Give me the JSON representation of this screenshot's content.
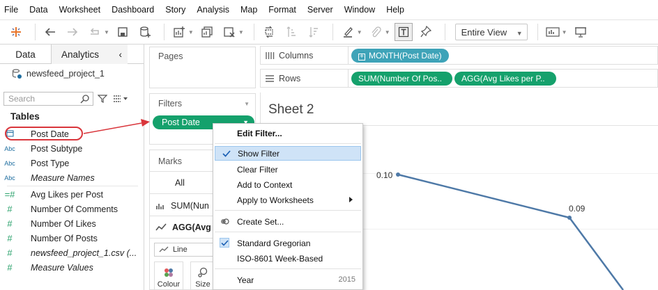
{
  "menu": [
    "File",
    "Data",
    "Worksheet",
    "Dashboard",
    "Story",
    "Analysis",
    "Map",
    "Format",
    "Server",
    "Window",
    "Help"
  ],
  "toolbar": {
    "fit_label": "Entire View"
  },
  "datapane": {
    "tab_data": "Data",
    "tab_analytics": "Analytics",
    "datasource": "newsfeed_project_1",
    "search_placeholder": "Search",
    "tables_heading": "Tables",
    "fields": [
      {
        "icon": "calendar",
        "label": "Post Date"
      },
      {
        "icon": "Abc",
        "label": "Post Subtype"
      },
      {
        "icon": "Abc",
        "label": "Post Type"
      },
      {
        "icon": "Abc",
        "label": "Measure Names"
      },
      {
        "icon": "=#",
        "label": "Avg Likes per Post"
      },
      {
        "icon": "#",
        "label": "Number Of Comments"
      },
      {
        "icon": "#",
        "label": "Number Of Likes"
      },
      {
        "icon": "#",
        "label": "Number Of Posts"
      },
      {
        "icon": "#",
        "label": "newsfeed_project_1.csv (..."
      },
      {
        "icon": "#",
        "label": "Measure Values"
      }
    ]
  },
  "cards": {
    "pages": "Pages",
    "filters": "Filters",
    "filter_pill": "Post Date",
    "marks": "Marks",
    "marks_all": "All",
    "marks_sum": "SUM(Nun",
    "marks_agg": "AGG(Avg",
    "mark_type": "Line",
    "color_label": "Colour",
    "size_label": "Size"
  },
  "shelves": {
    "columns_label": "Columns",
    "rows_label": "Rows",
    "columns_pill": "MONTH(Post Date)",
    "rows_pill_1": "SUM(Number Of Pos..",
    "rows_pill_2": "AGG(Avg Likes per P.."
  },
  "sheet": {
    "title": "Sheet 2",
    "label_a": "0.10",
    "label_b": "0.09"
  },
  "chart_data": {
    "type": "line",
    "title": "Sheet 2",
    "series": [
      {
        "values": [
          0.1,
          0.09
        ]
      }
    ]
  },
  "context_menu": {
    "edit_filter": "Edit Filter...",
    "show_filter": "Show Filter",
    "clear_filter": "Clear Filter",
    "add_to_context": "Add to Context",
    "apply_to_worksheets": "Apply to Worksheets",
    "create_set": "Create Set...",
    "standard_gregorian": "Standard Gregorian",
    "iso_week": "ISO-8601 Week-Based",
    "year": "Year",
    "year_value": "2015"
  },
  "colors": {
    "pill_green": "#15a16c",
    "pill_blue": "#3ea3b8",
    "line": "#4e79a7",
    "annotation_red": "#d9353b",
    "menu_highlight": "#cfe3f7"
  }
}
